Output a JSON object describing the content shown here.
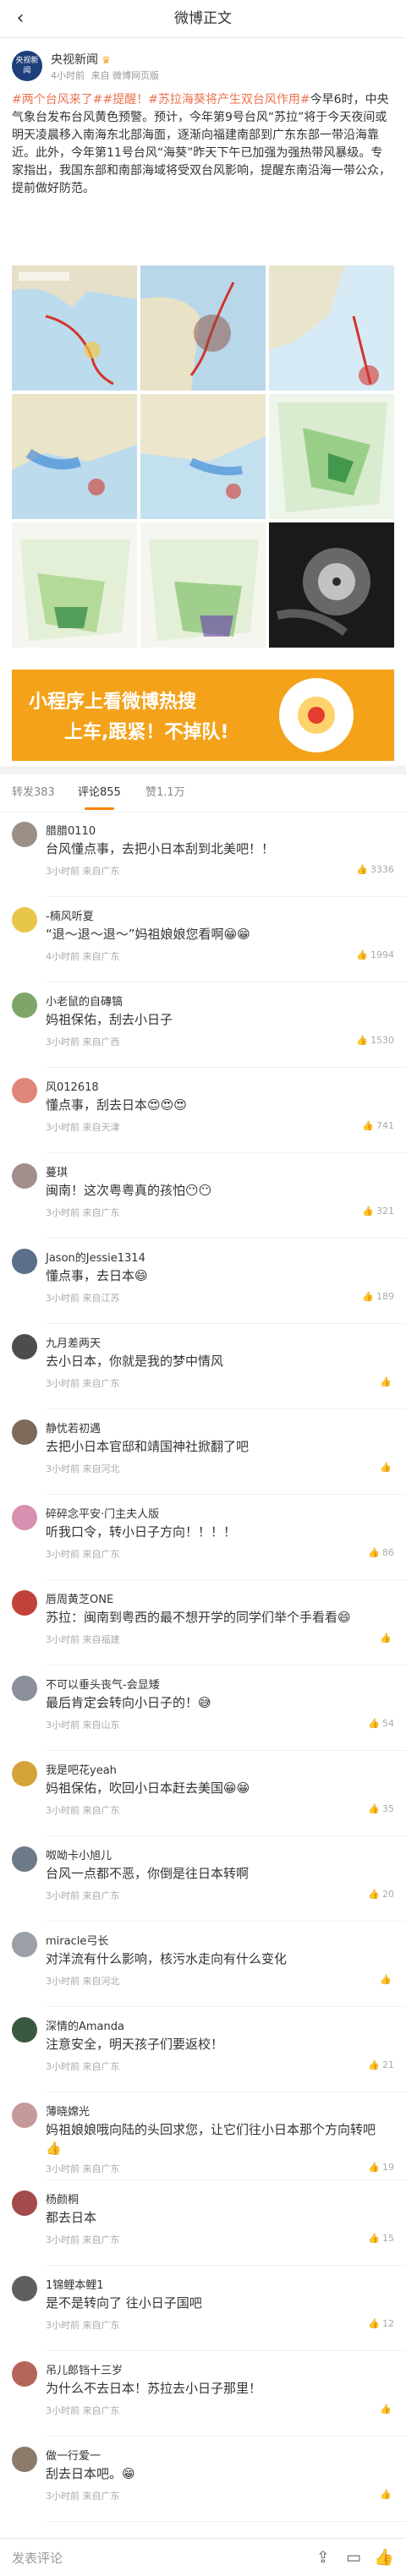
{
  "topbar": {
    "title": "微博正文",
    "back_icon": "chevron-left-icon"
  },
  "post": {
    "author": "央视新闻",
    "avatar_text": "央视新闻",
    "badge_icon": "crown-icon",
    "time": "4小时前",
    "source": "来自 微博网页版",
    "tag1": "#两个台风来了#",
    "tag2": "#提醒！#苏拉海葵将产生双台风作用#",
    "body": "今早6时，中央气象台发布台风黄色预警。预计，今年第9号台风“苏拉”将于今天夜间或明天凌晨移入南海东北部海面，逐渐向福建南部到广东东部一带沿海靠近。此外，今年第11号台风“海葵”昨天下午已加强为强热带风暴级。专家指出，我国东部和南部海域将受双台风影响，提醒东南沿海一带公众，提前做好防范。"
  },
  "banner": {
    "line1": "小程序上看微博热搜",
    "line2": "上车,跟紧！不掉队!",
    "bg_color": "#f4a21a"
  },
  "tabs": {
    "repost": "转发383",
    "comment": "评论855",
    "like": "赞1.1万"
  },
  "comments": [
    {
      "name": "腊腊0110",
      "text": "台风懂点事，去把小日本刮到北美吧！！",
      "time": "3小时前",
      "loc": "来自广东",
      "likes": "3336",
      "avatar_color": "#9a8f87"
    },
    {
      "name": "-楠风听夏",
      "text": "“退～退～退～”妈祖娘娘您看啊😁😁",
      "time": "4小时前",
      "loc": "来自广东",
      "likes": "1994",
      "avatar_color": "#e8c64a"
    },
    {
      "name": "小老鼠的自磚镐",
      "text": "妈祖保佑，刮去小日子",
      "time": "3小时前",
      "loc": "来自广西",
      "likes": "1530",
      "avatar_color": "#7fa66a"
    },
    {
      "name": "风012618",
      "text": "懂点事，刮去日本😍😍😍",
      "time": "3小时前",
      "loc": "来自天津",
      "likes": "741",
      "avatar_color": "#e0857a"
    },
    {
      "name": "蔓琪",
      "text": "闽南！这次粤粤真的孩怕😶😶",
      "time": "3小时前",
      "loc": "来自广东",
      "likes": "321",
      "avatar_color": "#a38e8e"
    },
    {
      "name": "Jason的Jessie1314",
      "text": "懂点事，去日本😄",
      "time": "3小时前",
      "loc": "来自江苏",
      "likes": "189",
      "avatar_color": "#5a6f8a"
    },
    {
      "name": "九月差两天",
      "text": "去小日本，你就是我的梦中情风",
      "time": "3小时前",
      "loc": "来自广东",
      "likes": "",
      "avatar_color": "#4d4d4d"
    },
    {
      "name": "静忧若初遇",
      "text": "去把小日本官邸和靖国神社掀翻了吧",
      "time": "3小时前",
      "loc": "来自河北",
      "likes": "",
      "avatar_color": "#7d6a5a"
    },
    {
      "name": "碎碎念平安·门主夫人版",
      "text": "听我口令，转小日子方向！！！！",
      "time": "3小时前",
      "loc": "来自广东",
      "likes": "86",
      "avatar_color": "#d98fb0"
    },
    {
      "name": "唇周黄芝ONE",
      "text": "苏拉：闽南到粤西的最不想开学的同学们举个手看看😄",
      "time": "3小时前",
      "loc": "来自福建",
      "likes": "",
      "avatar_color": "#c0423a"
    },
    {
      "name": "不可以垂头丧气-会显矮",
      "text": "最后肯定会转向小日子的！😅",
      "time": "3小时前",
      "loc": "来自山东",
      "likes": "54",
      "avatar_color": "#8a8f9a"
    },
    {
      "name": "我是吧花yeah",
      "text": "妈祖保佑，吹回小日本赶去美国😁😁",
      "time": "3小时前",
      "loc": "来自广东",
      "likes": "35",
      "avatar_color": "#d6a23a"
    },
    {
      "name": "呶呦卡小旭儿",
      "text": "台风一点都不恶，你倒是往日本转啊",
      "time": "3小时前",
      "loc": "来自广东",
      "likes": "20",
      "avatar_color": "#6d7a88"
    },
    {
      "name": "miracle弓长",
      "text": "对洋流有什么影响，核污水走向有什么变化",
      "time": "3小时前",
      "loc": "来自河北",
      "likes": "",
      "avatar_color": "#9aa0a6"
    },
    {
      "name": "深情的Amanda",
      "text": "注意安全，明天孩子们要返校！",
      "time": "3小时前",
      "loc": "来自广东",
      "likes": "21",
      "avatar_color": "#3a5a40"
    },
    {
      "name": "薄晓嫦光",
      "text": "妈祖娘娘哦向陆的头回求您，让它们往小日本那个方向转吧👍",
      "time": "3小时前",
      "loc": "来自广东",
      "likes": "19",
      "avatar_color": "#c49a9a"
    },
    {
      "name": "杨颜桐",
      "text": "都去日本",
      "time": "3小时前",
      "loc": "来自广东",
      "likes": "15",
      "avatar_color": "#a34a4a"
    },
    {
      "name": "1锦鲤本鲤1",
      "text": "是不是转向了 往小日子国吧",
      "time": "3小时前",
      "loc": "来自广东",
      "likes": "12",
      "avatar_color": "#5f5f5f"
    },
    {
      "name": "吊儿郎铛十三岁",
      "text": "为什么不去日本！苏拉去小日子那里！",
      "time": "3小时前",
      "loc": "来自广东",
      "likes": "",
      "avatar_color": "#b5655a"
    },
    {
      "name": "做一行爱一",
      "text": "刮去日本吧。😁",
      "time": "3小时前",
      "loc": "来自广东",
      "likes": "",
      "avatar_color": "#8c7a6b"
    }
  ],
  "bottombar": {
    "placeholder": "发表评论",
    "share_icon": "share-icon",
    "comment_icon": "comment-icon",
    "like_icon": "thumb-up-icon"
  }
}
